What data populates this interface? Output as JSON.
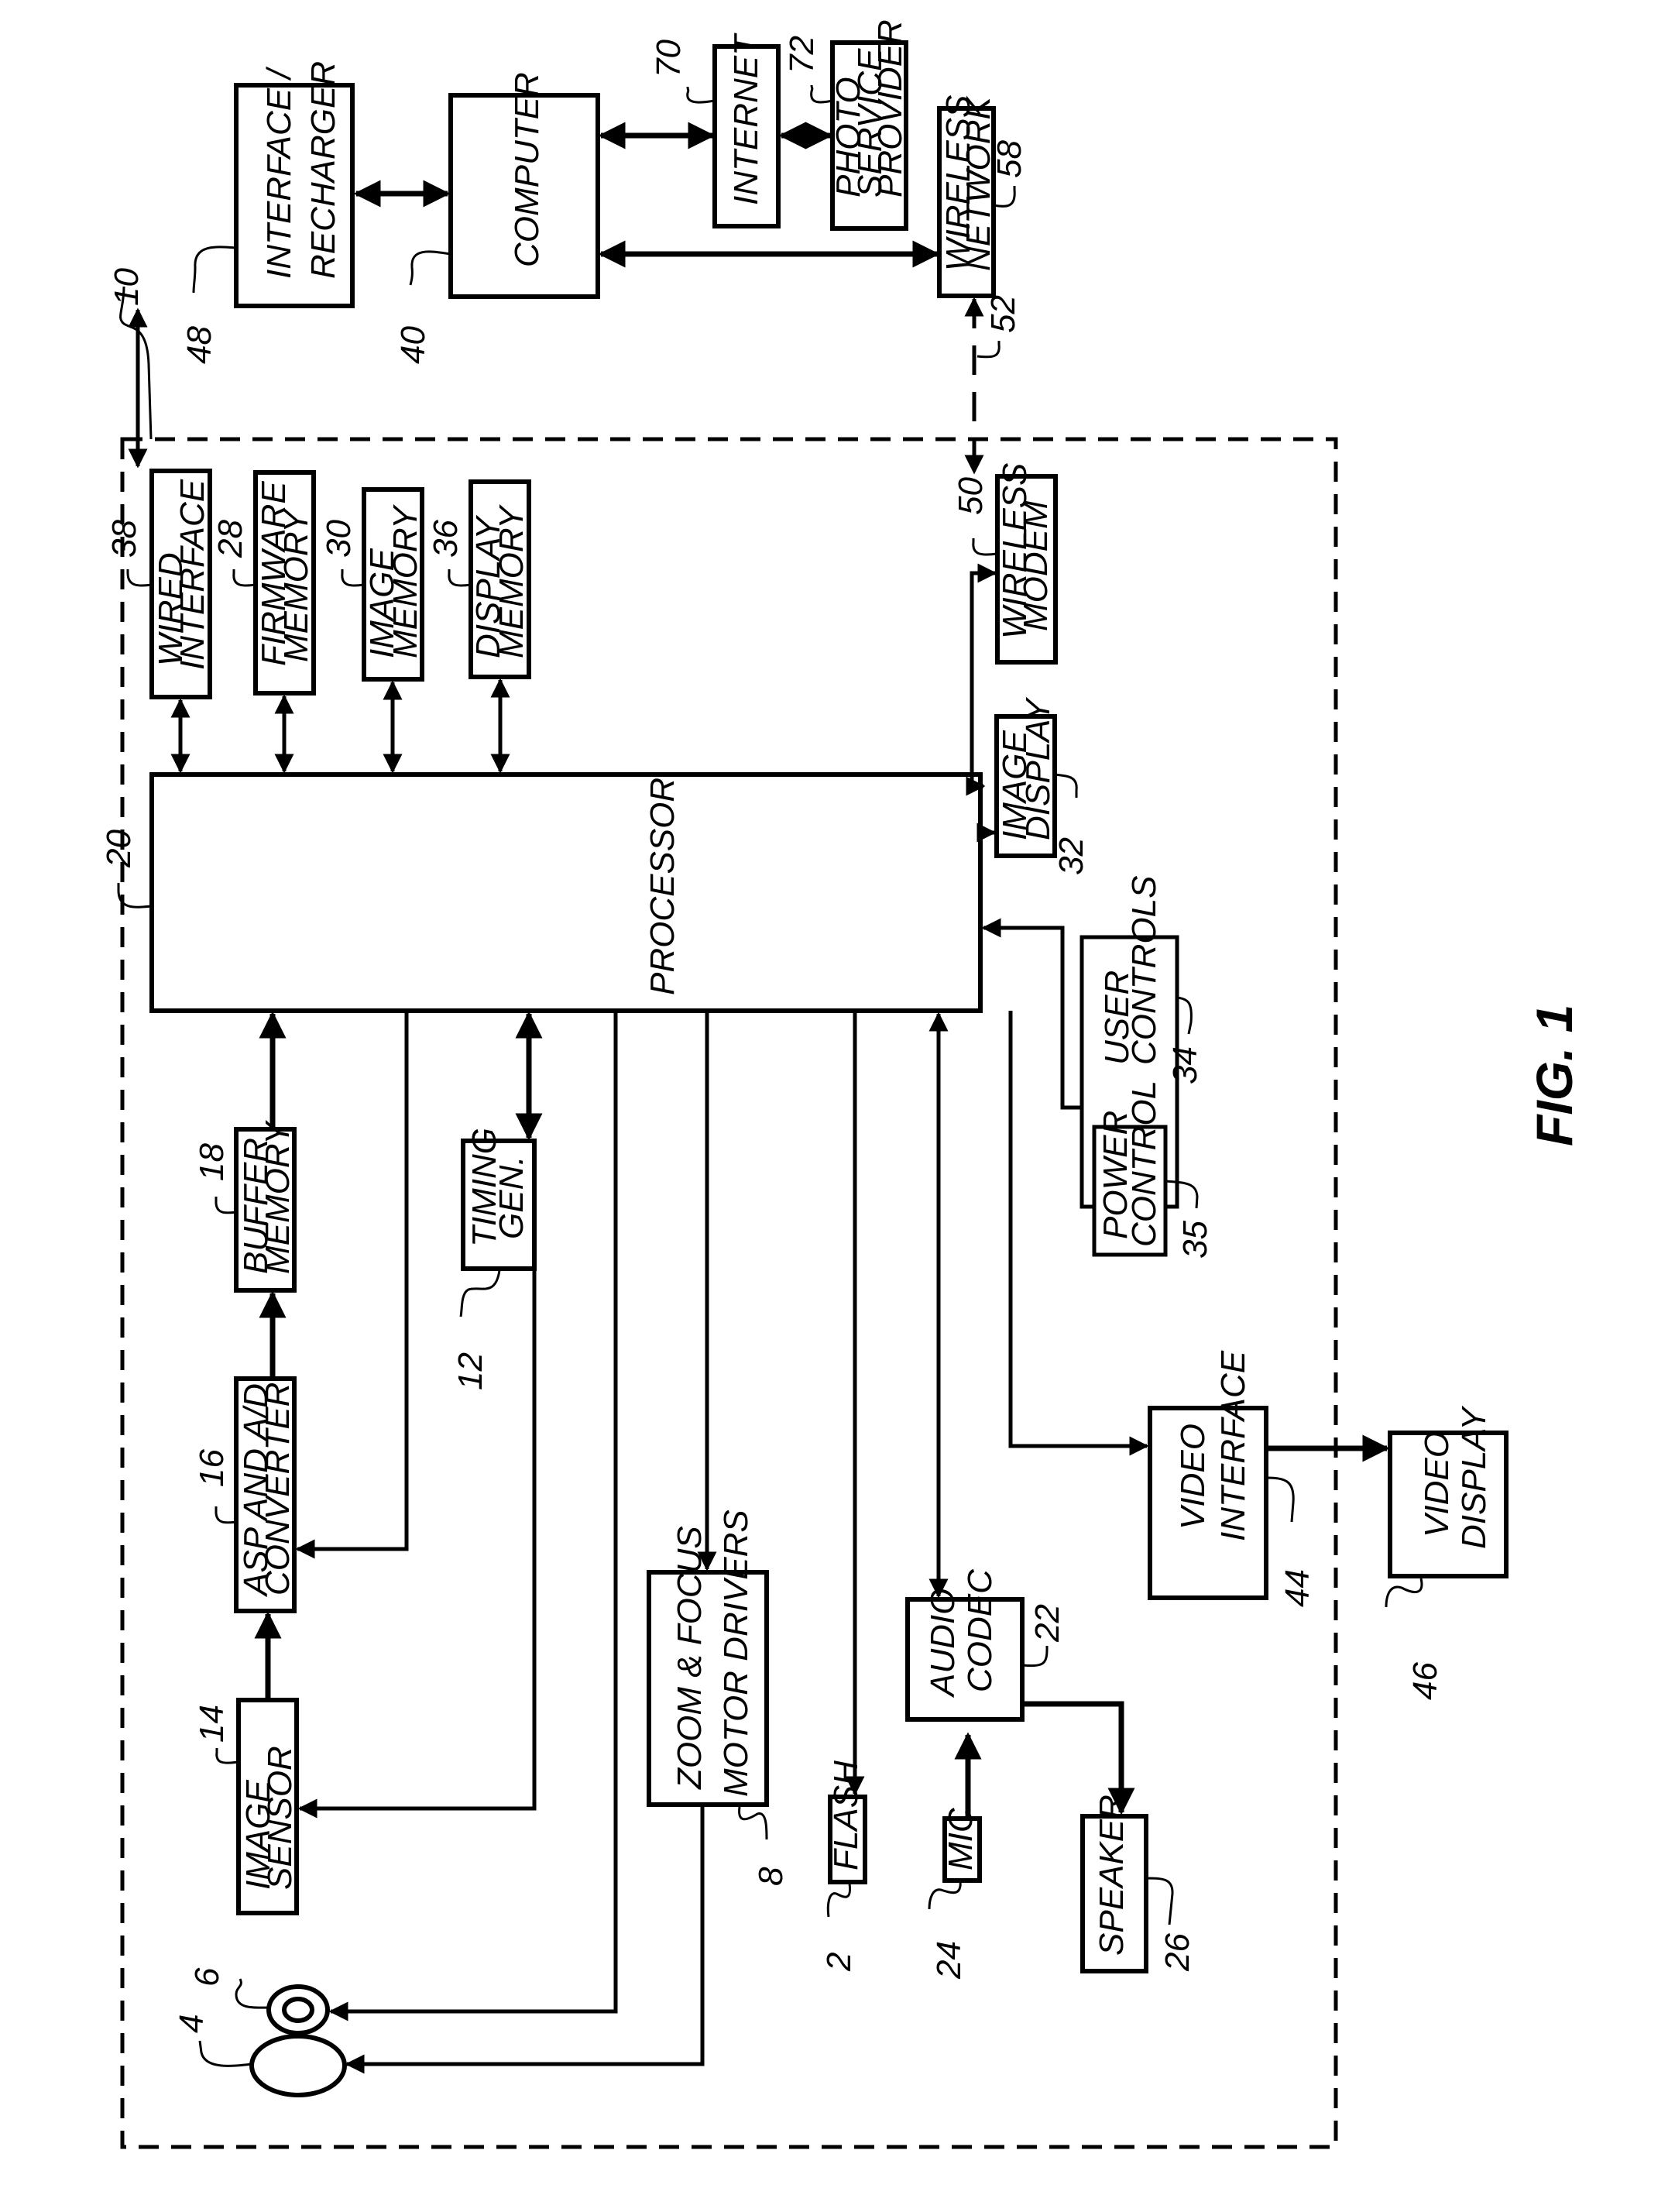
{
  "figure": {
    "title": "FIG. 1",
    "system_ref": "10"
  },
  "blocks": {
    "interface_recharger": {
      "line1": "INTERFACE /",
      "line2": "RECHARGER",
      "ref": "48"
    },
    "computer": {
      "line1": "COMPUTER",
      "ref": "40"
    },
    "internet": {
      "line1": "INTERNET",
      "ref": "70"
    },
    "photo_service_provider": {
      "line1": "PHOTO",
      "line2": "SERVICE",
      "line3": "PROVIDER",
      "ref": "72"
    },
    "wireless_network": {
      "line1": "WIRELESS",
      "line2": "NETWORK",
      "ref": "58"
    },
    "wireless_link": {
      "ref": "52"
    },
    "wired_interface": {
      "line1": "WIRED",
      "line2": "INTERFACE",
      "ref": "38"
    },
    "firmware_memory": {
      "line1": "FIRMWARE",
      "line2": "MEMORY",
      "ref": "28"
    },
    "image_memory": {
      "line1": "IMAGE",
      "line2": "MEMORY",
      "ref": "30"
    },
    "display_memory": {
      "line1": "DISPLAY",
      "line2": "MEMORY",
      "ref": "36"
    },
    "wireless_modem": {
      "line1": "WIRELESS",
      "line2": "MODEM",
      "ref": "50"
    },
    "processor": {
      "line1": "PROCESSOR",
      "ref": "20"
    },
    "image_display": {
      "line1": "IMAGE",
      "line2": "DISPLAY",
      "ref": "32"
    },
    "user_controls": {
      "line1": "USER",
      "line2": "CONTROLS",
      "ref": "34"
    },
    "power_control": {
      "line1": "POWER",
      "line2": "CONTROL",
      "ref": "35"
    },
    "buffer_memory": {
      "line1": "BUFFER",
      "line2": "MEMORY",
      "ref": "18"
    },
    "timing_gen": {
      "line1": "TIMING",
      "line2": "GEN.",
      "ref": "12"
    },
    "asp_converter": {
      "line1": "ASP AND A/D",
      "line2": "CONVERTER",
      "ref": "16"
    },
    "image_sensor": {
      "line1": "IMAGE",
      "line2": "SENSOR",
      "ref": "14"
    },
    "zoom_focus_drivers": {
      "line1": "ZOOM & FOCUS",
      "line2": "MOTOR DRIVERS",
      "ref": "8"
    },
    "flash": {
      "line1": "FLASH",
      "ref": "2"
    },
    "mic": {
      "line1": "MIC",
      "ref": "24"
    },
    "audio_codec": {
      "line1": "AUDIO",
      "line2": "CODEC",
      "ref": "22"
    },
    "speaker": {
      "line1": "SPEAKER",
      "ref": "26"
    },
    "video_interface": {
      "line1": "VIDEO",
      "line2": "INTERFACE",
      "ref": "44"
    },
    "video_display": {
      "line1": "VIDEO",
      "line2": "DISPLAY",
      "ref": "46"
    },
    "lens": {
      "ref": "4"
    },
    "aperture": {
      "ref": "6"
    }
  }
}
